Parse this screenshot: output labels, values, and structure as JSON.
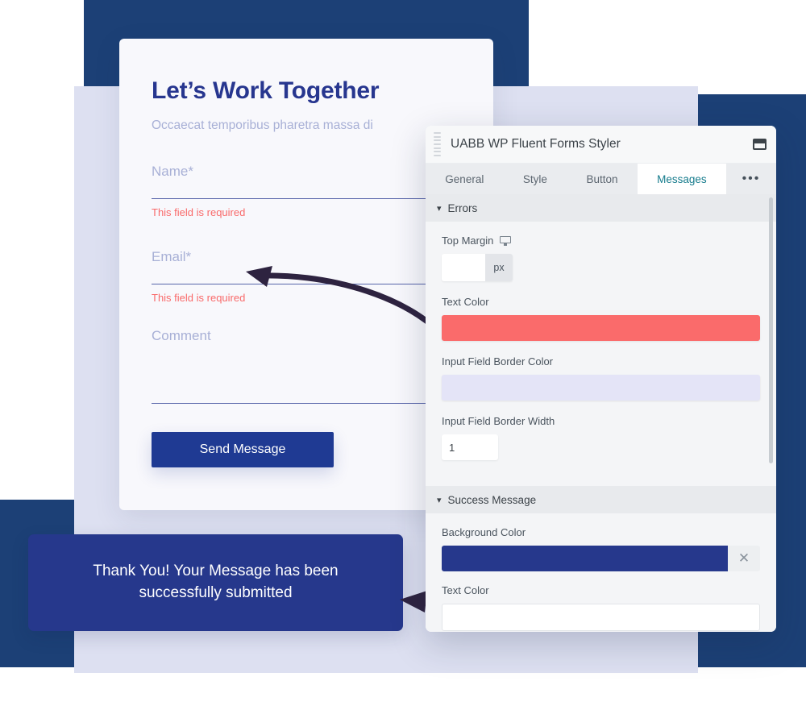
{
  "background": {
    "navy": "#1C4076",
    "lavender": "#DDE0F1",
    "card": "#F8F8FC"
  },
  "form": {
    "title": "Let’s Work Together",
    "subtitle": "Occaecat temporibus pharetra massa di",
    "fields": [
      {
        "label": "Name*",
        "error": "This field is required"
      },
      {
        "label": "Email*",
        "error": "This field is required"
      },
      {
        "label": "Comment",
        "error": ""
      }
    ],
    "submit_label": "Send Message",
    "submit_color": "#1F3A93",
    "title_color": "#27368F",
    "error_color": "#F96A6A"
  },
  "success_toast": {
    "message": "Thank You! Your Message has been successfully submitted",
    "background": "#26388C",
    "text_color": "#FFFFFF"
  },
  "panel": {
    "title": "UABB WP Fluent Forms Styler",
    "grip_icon": "drag-grip-icon",
    "window_icon": "restore-window-icon",
    "tabs": [
      {
        "label": "General",
        "active": false
      },
      {
        "label": "Style",
        "active": false
      },
      {
        "label": "Button",
        "active": false
      },
      {
        "label": "Messages",
        "active": true
      },
      {
        "label": "•••",
        "active": false
      }
    ],
    "active_tab_color": "#157B8C",
    "sections": [
      {
        "title": "Errors",
        "expanded": true,
        "controls": [
          {
            "type": "unit-number",
            "label": "Top Margin",
            "device_icon": "desktop-monitor-icon",
            "value": "",
            "placeholder": "",
            "unit": "px"
          },
          {
            "type": "color",
            "label": "Text Color",
            "value": "#FA6B6B"
          },
          {
            "type": "color",
            "label": "Input Field Border Color",
            "value": "#E4E4F7"
          },
          {
            "type": "number",
            "label": "Input Field Border Width",
            "value": "1"
          }
        ]
      },
      {
        "title": "Success Message",
        "expanded": true,
        "controls": [
          {
            "type": "color-clearable",
            "label": "Background Color",
            "value": "#26388C",
            "clear_icon": "close-icon"
          },
          {
            "type": "text",
            "label": "Text Color",
            "value": "",
            "placeholder": ""
          }
        ]
      }
    ]
  }
}
